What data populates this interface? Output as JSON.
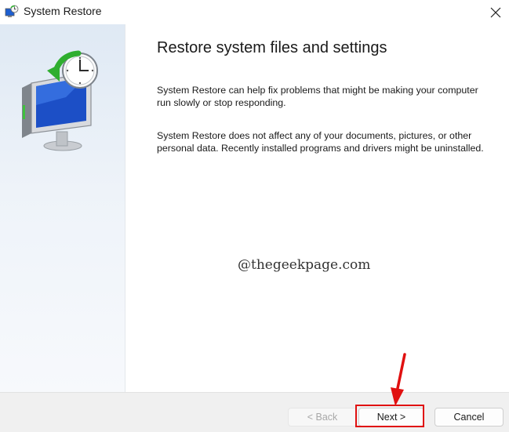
{
  "window": {
    "title": "System Restore",
    "icons": {
      "app": "system-restore-icon",
      "close": "close-icon"
    }
  },
  "main": {
    "heading": "Restore system files and settings",
    "paragraph1": "System Restore can help fix problems that might be making your computer run slowly or stop responding.",
    "paragraph2": "System Restore does not affect any of your documents, pictures, or other personal data. Recently installed programs and drivers might be uninstalled.",
    "watermark": "@thegeekpage.com"
  },
  "footer": {
    "back_label": "< Back",
    "next_label": "Next >",
    "cancel_label": "Cancel"
  },
  "annotation": {
    "highlight_color": "#e01010",
    "arrow_color": "#e01010",
    "target": "Next >"
  },
  "colors": {
    "sidebar_top": "#dfe9f4",
    "footer_bg": "#f0f0f0"
  }
}
